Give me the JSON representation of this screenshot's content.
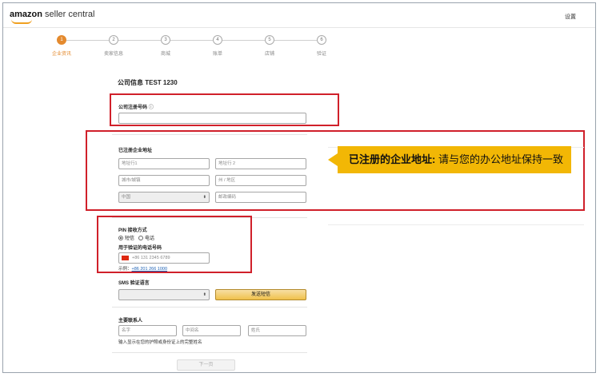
{
  "header": {
    "logo_brand": "amazon",
    "logo_rest": " seller central",
    "settings_label": "设置"
  },
  "steps": [
    {
      "num": "1",
      "label": "企业资讯",
      "active": true
    },
    {
      "num": "2",
      "label": "卖家信息",
      "active": false
    },
    {
      "num": "3",
      "label": "商城",
      "active": false
    },
    {
      "num": "4",
      "label": "账单",
      "active": false
    },
    {
      "num": "5",
      "label": "店铺",
      "active": false
    },
    {
      "num": "6",
      "label": "验证",
      "active": false
    }
  ],
  "form": {
    "title": "公司信息 TEST 1230",
    "reg_number_label": "公司注册号码",
    "address_label": "已注册企业地址",
    "addr1_placeholder": "地址行1",
    "addr2_placeholder": "地址行 2",
    "city_placeholder": "城市/城镇",
    "state_placeholder": "州 / 地区",
    "country_value": "中国",
    "postcode_placeholder": "邮政编码",
    "pin_label": "PIN 接收方式",
    "pin_option_sms": "短信",
    "pin_option_call": "电话",
    "phone_label": "用于验证的电话号码",
    "phone_placeholder": "+86 131 2345 6789",
    "example_prefix": "示例：",
    "example_number": "+86 201 266 1000",
    "sms_lang_label": "SMS 验证语言",
    "send_button": "发送短信",
    "contact_label": "主要联系人",
    "first_name_placeholder": "名字",
    "middle_name_placeholder": "中间名",
    "last_name_placeholder": "姓氏",
    "contact_hint": "输入显示在您的护照或身份证上的完整姓名",
    "next_button": "下一页"
  },
  "callout": {
    "bold": "已注册的企业地址:",
    "rest": " 请与您的办公地址保持一致"
  },
  "colors": {
    "accent": "#e48a2e",
    "highlight_red": "#d0202a",
    "callout_yellow": "#f2b705"
  }
}
